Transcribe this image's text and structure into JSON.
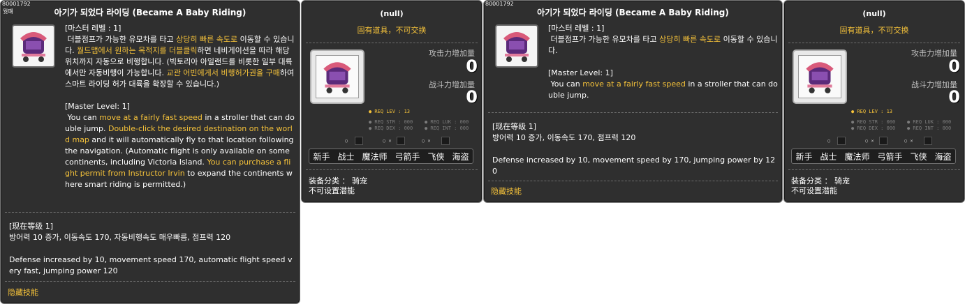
{
  "skill_panels": [
    {
      "code": "80001792",
      "corner_label": "뭣퍠",
      "title": "아기가 되었다 라이딩 (Became A Baby Riding)",
      "desc_segments": [
        {
          "t": "[마스터 레벨 : 1]\n 더블점프가 가능한 유모차를 타고 ",
          "hl": false
        },
        {
          "t": "상당히 빠른 속도로",
          "hl": true
        },
        {
          "t": " 이동할 수 있습니다. ",
          "hl": false
        },
        {
          "t": "월드맵에서 원하는 목적지를 더블클릭",
          "hl": true
        },
        {
          "t": "하면 네비게이션을 따라 해당 위치까지 자동으로 비행합니다. (빅토리아 아일랜드를 비롯한 일부 대륙에서만 자동비행이 가능합니다. ",
          "hl": false
        },
        {
          "t": "교관 어빈에게서 비행허가권을 구매",
          "hl": true
        },
        {
          "t": "하여 스마트 라이딩 허가 대륙을 확장할 수 있습니다.)\n\n[Master Level: 1]\n You can ",
          "hl": false
        },
        {
          "t": "move at a fairly fast speed",
          "hl": true
        },
        {
          "t": " in a stroller that can double jump. ",
          "hl": false
        },
        {
          "t": "Double-click the desired destination on the world map",
          "hl": true
        },
        {
          "t": " and it will automatically fly to that location following the navigation. (Automatic flight is only available on some continents, including Victoria Island. ",
          "hl": false
        },
        {
          "t": "You can purchase a flight permit from Instructor Irvin",
          "hl": true
        },
        {
          "t": " to expand the continents where smart riding is permitted.)",
          "hl": false
        }
      ],
      "current_level": "[现在等级 1]\n방어력 10 증가, 이동속도 170, 자동비행속도 매우빠름, 점프력 120\n\nDefense increased by 10, movement speed 170, automatic flight speed very fast, jumping power 120",
      "footer": "隐藏技能"
    },
    {
      "code": "80001792",
      "corner_label": "",
      "title": "아기가 되었다 라이딩 (Became A Baby Riding)",
      "desc_segments": [
        {
          "t": "[마스터 레벨 : 1]\n 더블점프가 가능한 유모차를 타고 ",
          "hl": false
        },
        {
          "t": "상당히 빠른 속도로",
          "hl": true
        },
        {
          "t": " 이동할 수 있습니다.\n\n[Master Level: 1]\n You can ",
          "hl": false
        },
        {
          "t": "move at a fairly fast speed",
          "hl": true
        },
        {
          "t": " in a stroller that can double jump.",
          "hl": false
        }
      ],
      "current_level": "[现在等级 1]\n방어력 10 증가, 이동속도 170, 점프력 120\n\nDefense increased by 10, movement speed by 170, jumping power by 120",
      "footer": "隐藏技能"
    }
  ],
  "equip_panels": [
    {
      "name": "(null)",
      "subtitle": "固有道具，不可交换",
      "attack_label": "攻击力增加量",
      "attack_value": "0",
      "combat_label": "战斗力增加量",
      "combat_value": "0",
      "req_lev": "● REQ LEV :  13",
      "req_str": "● REQ STR : 000",
      "req_luk": "● REQ LUK : 000",
      "req_dex": "● REQ DEX : 000",
      "req_int": "● REQ INT : 000",
      "dot_labels": [
        "○",
        "○ ✕",
        "○ ✕"
      ],
      "jobs": [
        "新手",
        "战士",
        "魔法师",
        "弓箭手",
        "飞侠",
        "海盗"
      ],
      "category": "装备分类 ： 骑宠",
      "potential": "不可设置潜能"
    },
    {
      "name": "(null)",
      "subtitle": "固有道具，不可交换",
      "attack_label": "攻击力增加量",
      "attack_value": "0",
      "combat_label": "战斗力增加量",
      "combat_value": "0",
      "req_lev": "● REQ LEV :  13",
      "req_str": "● REQ STR : 000",
      "req_luk": "● REQ LUK : 000",
      "req_dex": "● REQ DEX : 000",
      "req_int": "● REQ INT : 000",
      "dot_labels": [
        "○",
        "○ ✕",
        "○ ✕"
      ],
      "jobs": [
        "新手",
        "战士",
        "魔法师",
        "弓箭手",
        "飞侠",
        "海盗"
      ],
      "category": "装备分类 ： 骑宠",
      "potential": "不可设置潜能"
    }
  ],
  "icons": [
    "stroller-icon"
  ],
  "colors": {
    "panel_bg": "#2f2f2f",
    "highlight": "#f5c23a",
    "border": "#7a7a7a"
  }
}
